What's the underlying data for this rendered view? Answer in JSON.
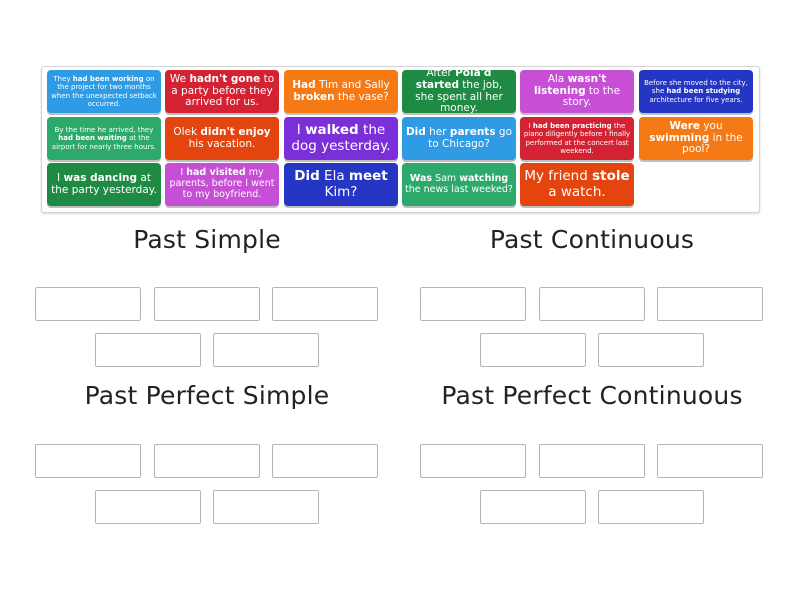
{
  "cards": [
    {
      "html_parts": [
        [
          "They ",
          false
        ],
        [
          "had been working",
          true
        ],
        [
          " on the project for two months when the unexpected setback occurred.",
          false
        ]
      ],
      "color": "#2f9be4",
      "size": "xs"
    },
    {
      "html_parts": [
        [
          "We ",
          false
        ],
        [
          "hadn't gone",
          true
        ],
        [
          " to a party before they arrived for us.",
          false
        ]
      ],
      "color": "#d32232",
      "size": "m"
    },
    {
      "html_parts": [
        [
          "Had",
          true
        ],
        [
          " Tim and Sally ",
          false
        ],
        [
          "broken",
          true
        ],
        [
          " the vase?",
          false
        ]
      ],
      "color": "#f57a15",
      "size": "m"
    },
    {
      "html_parts": [
        [
          "After ",
          false
        ],
        [
          "Pola'd started",
          true
        ],
        [
          " the job, she spent all her money.",
          false
        ]
      ],
      "color": "#1f8a43",
      "size": "m"
    },
    {
      "html_parts": [
        [
          "Ala ",
          false
        ],
        [
          "wasn't listening",
          true
        ],
        [
          " to the story.",
          false
        ]
      ],
      "color": "#c74fd6",
      "size": "m"
    },
    {
      "html_parts": [
        [
          "Before she moved to the city, she ",
          false
        ],
        [
          "had been studying",
          true
        ],
        [
          " architecture for five years.",
          false
        ]
      ],
      "color": "#2535c4",
      "size": "xs"
    },
    {
      "html_parts": [
        [
          "By the time he arrived, they ",
          false
        ],
        [
          "had been waiting",
          true
        ],
        [
          " at the airport for nearly three hours.",
          false
        ]
      ],
      "color": "#2ea96c",
      "size": "xs"
    },
    {
      "html_parts": [
        [
          "Olek ",
          false
        ],
        [
          "didn't enjoy",
          true
        ],
        [
          " his vacation.",
          false
        ]
      ],
      "color": "#e4450f",
      "size": "m"
    },
    {
      "html_parts": [
        [
          "I ",
          false
        ],
        [
          "walked",
          true
        ],
        [
          " the dog yesterday.",
          false
        ]
      ],
      "color": "#7a2fd8",
      "size": "l"
    },
    {
      "html_parts": [
        [
          "Did",
          true
        ],
        [
          " her ",
          false
        ],
        [
          "parents",
          true
        ],
        [
          " go to Chicago?",
          false
        ]
      ],
      "color": "#2f9be4",
      "size": "m"
    },
    {
      "html_parts": [
        [
          "I ",
          false
        ],
        [
          "had been practicing",
          true
        ],
        [
          " the piano diligently before I finally performed at the concert last weekend.",
          false
        ]
      ],
      "color": "#d32232",
      "size": "xs"
    },
    {
      "html_parts": [
        [
          "Were",
          true
        ],
        [
          " you ",
          false
        ],
        [
          "swimming",
          true
        ],
        [
          " in the pool?",
          false
        ]
      ],
      "color": "#f57a15",
      "size": "m"
    },
    {
      "html_parts": [
        [
          "I ",
          false
        ],
        [
          "was dancing",
          true
        ],
        [
          " at the party yesterday.",
          false
        ]
      ],
      "color": "#1f8a43",
      "size": "m"
    },
    {
      "html_parts": [
        [
          "I ",
          false
        ],
        [
          "had visited",
          true
        ],
        [
          " my parents, before I went to my boyfriend.",
          false
        ]
      ],
      "color": "#c74fd6",
      "size": "s"
    },
    {
      "html_parts": [
        [
          "Did",
          true
        ],
        [
          " Ela ",
          false
        ],
        [
          "meet",
          true
        ],
        [
          " Kim?",
          false
        ]
      ],
      "color": "#2535c4",
      "size": "l"
    },
    {
      "html_parts": [
        [
          "Was",
          true
        ],
        [
          " Sam ",
          false
        ],
        [
          "watching",
          true
        ],
        [
          " the news last weeked?",
          false
        ]
      ],
      "color": "#2ea96c",
      "size": "s"
    },
    {
      "html_parts": [
        [
          "My friend ",
          false
        ],
        [
          "stole",
          true
        ],
        [
          " a watch.",
          false
        ]
      ],
      "color": "#e4450f",
      "size": "l"
    }
  ],
  "groups": [
    {
      "title": "Past Simple",
      "slots": 5
    },
    {
      "title": "Past Continuous",
      "slots": 5
    },
    {
      "title": "Past Perfect Simple",
      "slots": 5
    },
    {
      "title": "Past Perfect Continuous",
      "slots": 5
    }
  ]
}
